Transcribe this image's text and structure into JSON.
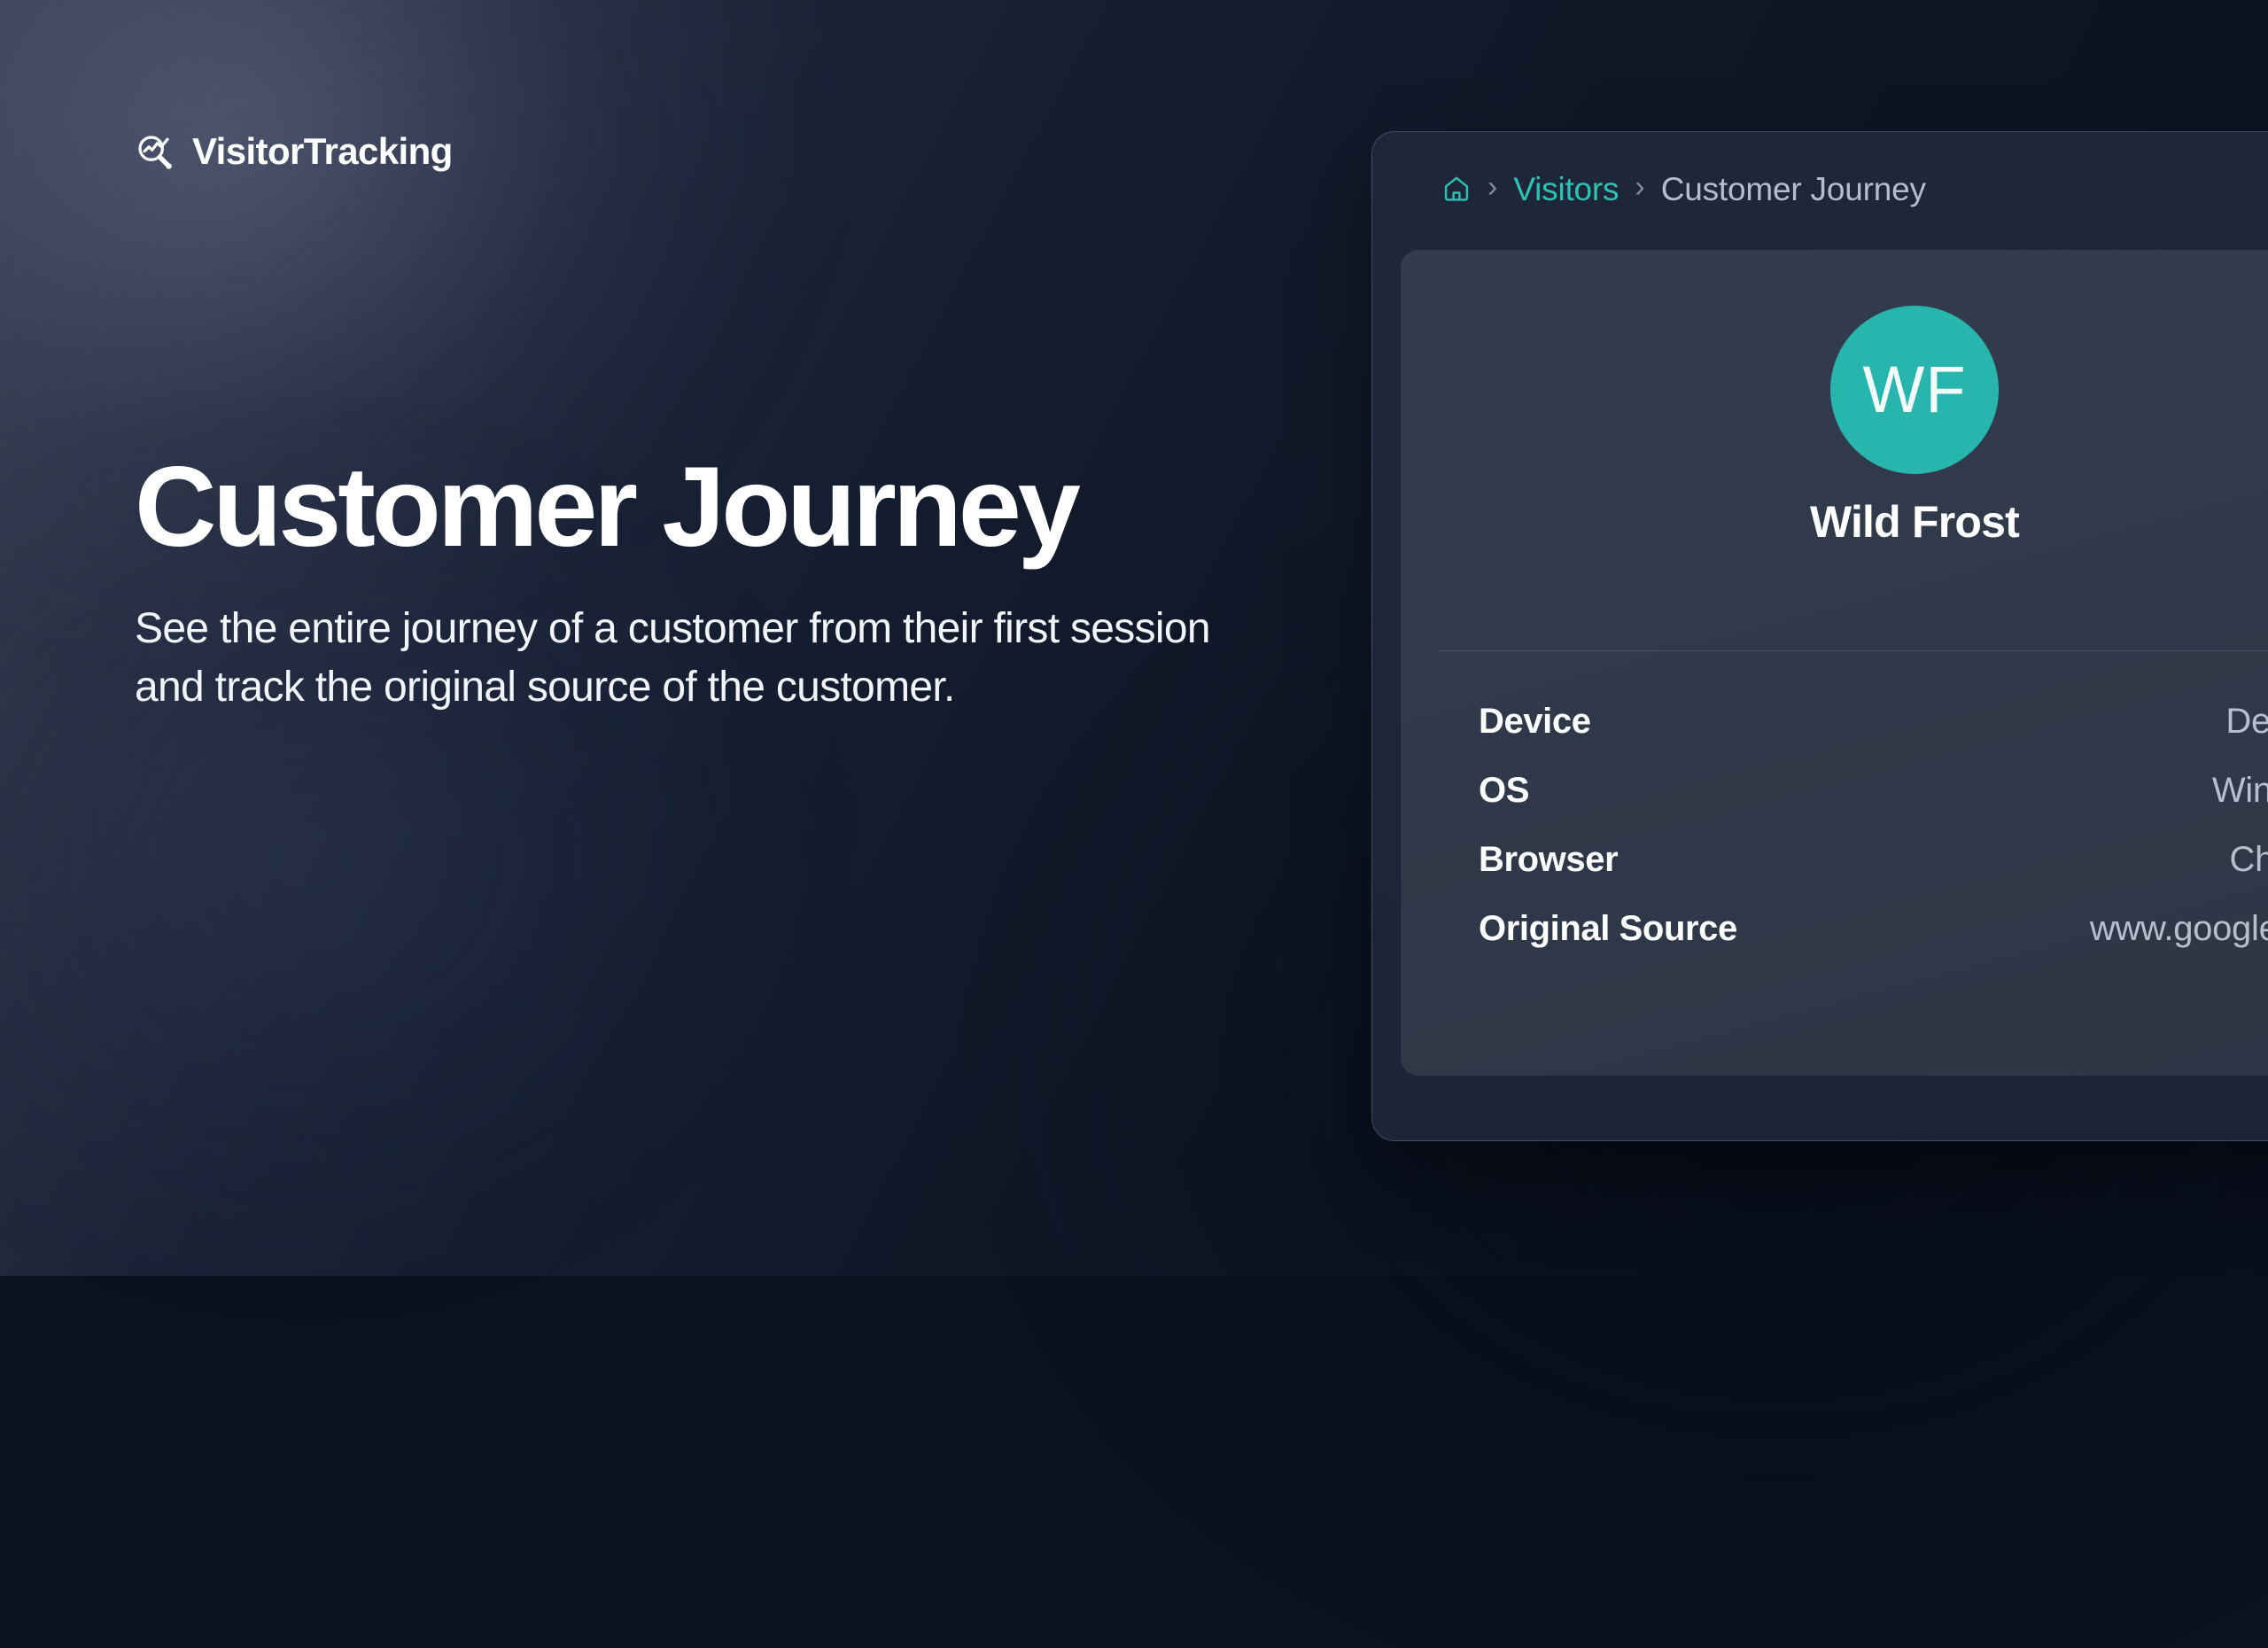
{
  "brand": {
    "name": "VisitorTracking",
    "logo_icon": "magnifier-chart-icon"
  },
  "hero": {
    "title": "Customer Journey",
    "subtitle": "See the entire journey of a customer from their first session and track the original source of the customer."
  },
  "app": {
    "breadcrumb": {
      "home_icon": "home-icon",
      "separator": "›",
      "items": [
        {
          "label": "Visitors",
          "current": false
        },
        {
          "label": "Customer Journey",
          "current": true
        }
      ]
    },
    "profile": {
      "avatar_initials": "WF",
      "name": "Wild Frost",
      "details": [
        {
          "label": "Device",
          "value": "Desktop"
        },
        {
          "label": "OS",
          "value": "Windows"
        },
        {
          "label": "Browser",
          "value": "Chrome"
        },
        {
          "label": "Original Source",
          "value": "www.google.com"
        }
      ]
    }
  },
  "colors": {
    "accent_teal": "#2bc4b4",
    "avatar_teal": "#27b5ad",
    "panel_bg": "#1d2537",
    "card_bg": "#303949",
    "page_bg_dark": "#0a1120",
    "text_primary": "#ffffff",
    "text_muted": "#b6bfcd"
  }
}
